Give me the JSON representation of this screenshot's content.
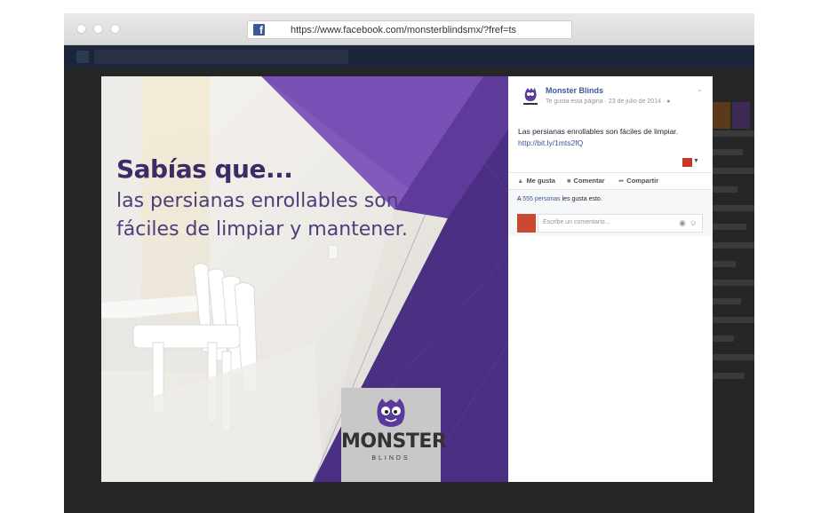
{
  "browser": {
    "url": "https://www.facebook.com/monsterblindsmx/?fref=ts",
    "favicon": "facebook-f-icon"
  },
  "photo": {
    "headline": "Sabías que...",
    "subheadline_line1": "las persianas enrollables son",
    "subheadline_line2": "fáciles de limpiar y mantener.",
    "logo_name": "MONSTER",
    "logo_sub": "BLINDS",
    "colors": {
      "purple_dark": "#3f2a70",
      "purple_mid": "#5e3a9a",
      "purple_light": "#7b52b8",
      "logo_bg": "#c8c8c8"
    }
  },
  "post": {
    "page_name": "Monster Blinds",
    "meta": "Te gusta esta página · 23 de julio de 2014 ·",
    "text": "Las persianas enrollables son fáciles de limpiar.",
    "link": "http://bit.ly/1mts2fQ",
    "actions": {
      "like": "Me gusta",
      "comment": "Comentar",
      "share": "Compartir"
    },
    "likes_link": "555 personas",
    "likes_suffix": "les gusta esto.",
    "likes_prefix": "A",
    "comment_placeholder": "Escribe un comentario..."
  }
}
